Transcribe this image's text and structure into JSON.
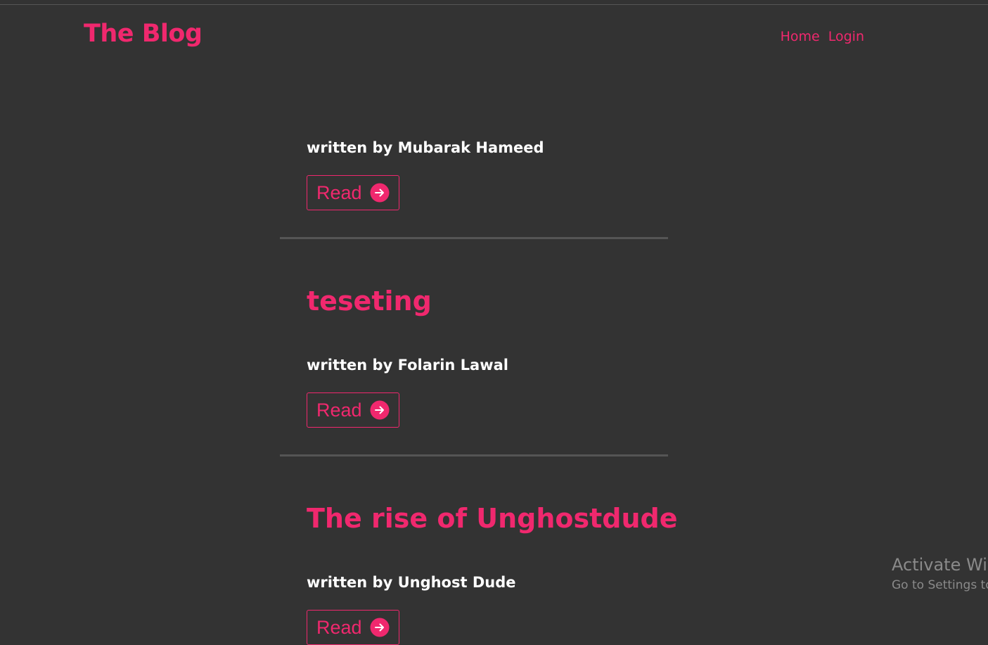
{
  "site": {
    "brand": "The Blog",
    "accent_color": "#f0286e",
    "background_color": "#333333"
  },
  "nav": {
    "items": [
      {
        "label": "Home"
      },
      {
        "label": "Login"
      }
    ]
  },
  "posts": [
    {
      "title": "",
      "author_line": "written by Mubarak Hameed",
      "read_label": "Read",
      "read_icon": "arrow-right-circle-icon"
    },
    {
      "title": "teseting",
      "author_line": "written by Folarin Lawal",
      "read_label": "Read",
      "read_icon": "arrow-right-circle-icon"
    },
    {
      "title": "The rise of Unghostdude",
      "author_line": "written by Unghost Dude",
      "read_label": "Read",
      "read_icon": "arrow-right-circle-icon"
    }
  ],
  "os_watermark": {
    "title": "Activate Win",
    "subtitle": "Go to Settings to"
  }
}
